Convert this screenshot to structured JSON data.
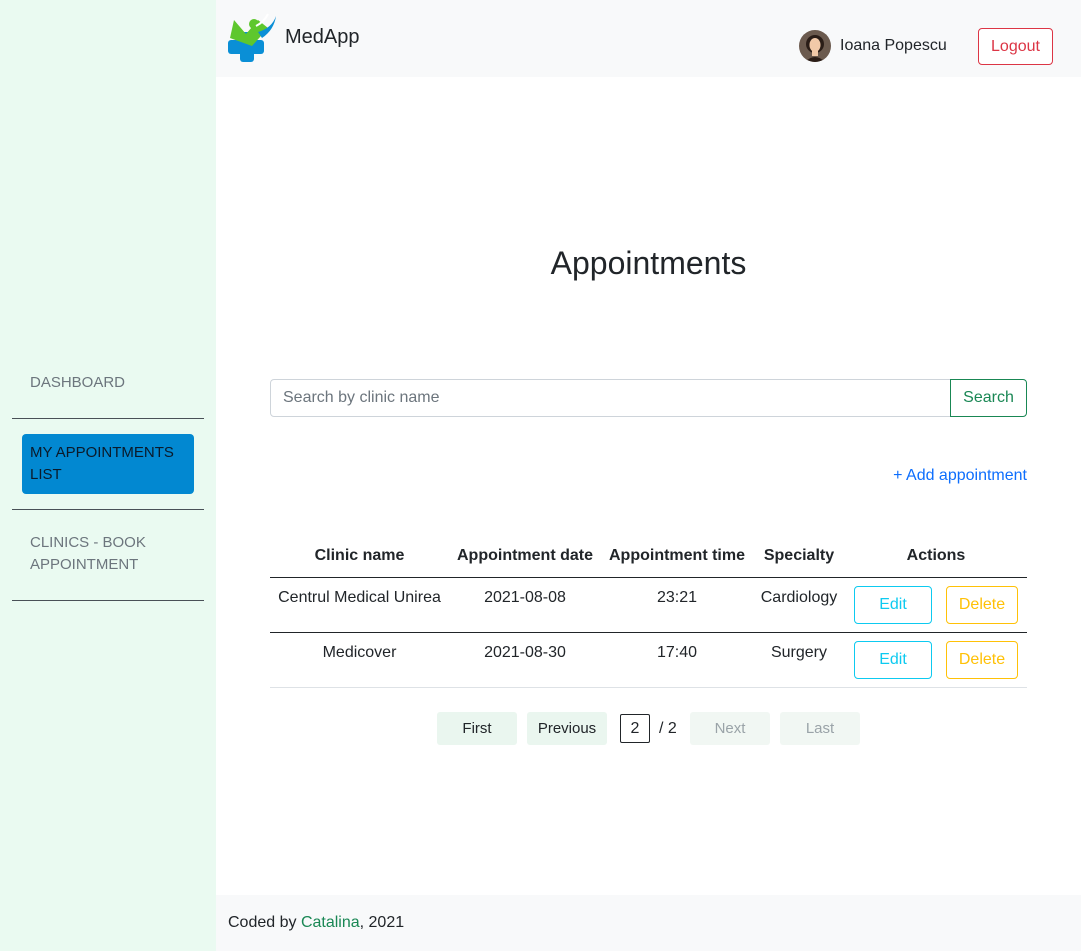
{
  "app": {
    "brand": "MedApp"
  },
  "header": {
    "username": "Ioana Popescu",
    "logout_label": "Logout"
  },
  "sidebar": {
    "items": [
      {
        "label": "DASHBOARD",
        "active": false
      },
      {
        "label": "MY APPOINTMENTS LIST",
        "active": true
      },
      {
        "label": "CLINICS - BOOK APPOINTMENT",
        "active": false
      }
    ]
  },
  "main": {
    "title": "Appointments",
    "search": {
      "placeholder": "Search by clinic name",
      "value": "",
      "button_label": "Search"
    },
    "add_label": "+ Add appointment",
    "table": {
      "columns": [
        "Clinic name",
        "Appointment date",
        "Appointment time",
        "Specialty",
        "Actions"
      ],
      "rows": [
        {
          "clinic": "Centrul Medical Unirea",
          "date": "2021-08-08",
          "time": "23:21",
          "specialty": "Cardiology"
        },
        {
          "clinic": "Medicover",
          "date": "2021-08-30",
          "time": "17:40",
          "specialty": "Surgery"
        }
      ],
      "edit_label": "Edit",
      "delete_label": "Delete"
    },
    "pagination": {
      "first_label": "First",
      "previous_label": "Previous",
      "current_page": "2",
      "total_text": "/ 2",
      "next_label": "Next",
      "last_label": "Last"
    }
  },
  "footer": {
    "prefix": "Coded by ",
    "author": "Catalina",
    "suffix": ", 2021"
  },
  "colors": {
    "sidebar_bg": "#eafaf1",
    "active_nav": "#0288d1",
    "danger": "#dc3545",
    "success": "#198754",
    "primary_link": "#0d6efd",
    "info": "#0dcaf0",
    "warning": "#ffc107"
  }
}
